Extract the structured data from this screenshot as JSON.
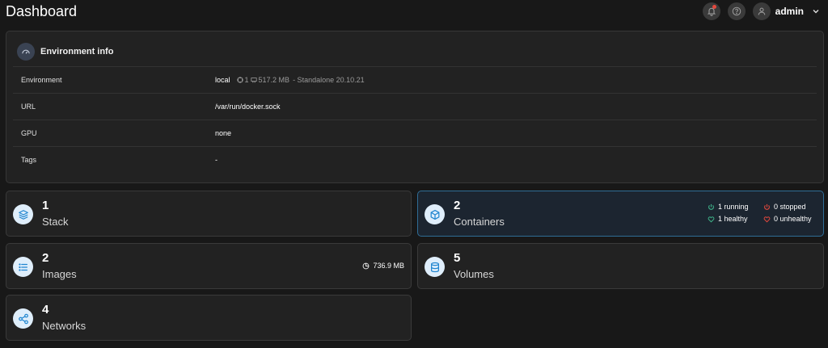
{
  "header": {
    "title": "Dashboard",
    "username": "admin",
    "icons": [
      "bell-icon",
      "help-icon",
      "user-icon",
      "chevron-down-icon"
    ]
  },
  "env": {
    "title": "Environment info",
    "rows": [
      {
        "label": "Environment",
        "value": "local",
        "cpu": "1",
        "memory": "517.2 MB",
        "type": "- Standalone 20.10.21"
      },
      {
        "label": "URL",
        "value": "/var/run/docker.sock"
      },
      {
        "label": "GPU",
        "value": "none"
      },
      {
        "label": "Tags",
        "value": "-"
      }
    ]
  },
  "stats": {
    "stack": {
      "count": "1",
      "label": "Stack"
    },
    "containers": {
      "count": "2",
      "label": "Containers",
      "running": "1 running",
      "stopped": "0 stopped",
      "healthy": "1 healthy",
      "unhealthy": "0 unhealthy"
    },
    "images": {
      "count": "2",
      "label": "Images",
      "size": "736.9 MB"
    },
    "volumes": {
      "count": "5",
      "label": "Volumes"
    },
    "networks": {
      "count": "4",
      "label": "Networks"
    }
  },
  "colors": {
    "accent": "#2f6d96",
    "icon_fill": "#1f85d0",
    "success": "#3fb68b",
    "danger": "#e5483d"
  }
}
